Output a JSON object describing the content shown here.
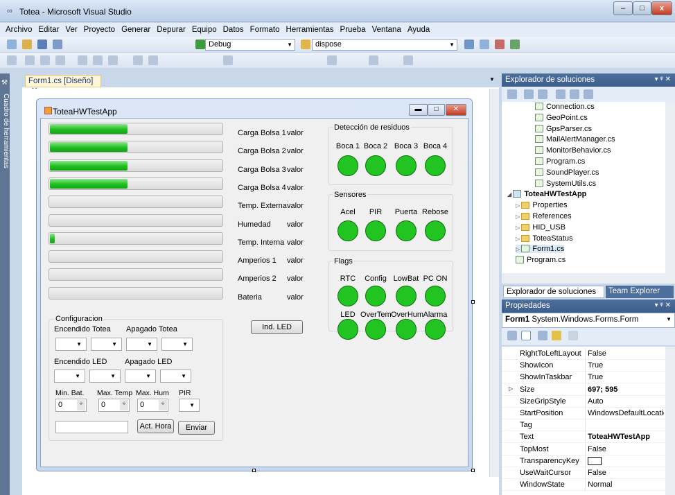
{
  "window": {
    "title": "Totea - Microsoft Visual Studio"
  },
  "menu": [
    "Archivo",
    "Editar",
    "Ver",
    "Proyecto",
    "Generar",
    "Depurar",
    "Equipo",
    "Datos",
    "Formato",
    "Herramientas",
    "Prueba",
    "Ventana",
    "Ayuda"
  ],
  "toolbar": {
    "config": "Debug",
    "platform": "dispose"
  },
  "left_rail": "Cuadro de herramientas",
  "document_tab": "Form1.cs [Diseño]",
  "form": {
    "title": "ToteaHWTestApp",
    "bars": [
      {
        "label": "Carga Bolsa 1",
        "value_label": "valor",
        "fill": 0.45
      },
      {
        "label": "Carga Bolsa 2",
        "value_label": "valor",
        "fill": 0.45
      },
      {
        "label": "Carga Bolsa 3",
        "value_label": "valor",
        "fill": 0.45
      },
      {
        "label": "Carga Bolsa 4",
        "value_label": "valor",
        "fill": 0.45
      },
      {
        "label": "Temp. Externa",
        "value_label": "valor",
        "fill": 0
      },
      {
        "label": "Humedad",
        "value_label": "valor",
        "fill": 0
      },
      {
        "label": "Temp. Interna",
        "value_label": "valor",
        "fill": 0.03
      },
      {
        "label": "Amperios 1",
        "value_label": "valor",
        "fill": 0
      },
      {
        "label": "Amperios 2",
        "value_label": "valor",
        "fill": 0
      },
      {
        "label": "Bateria",
        "value_label": "valor",
        "fill": 0
      }
    ],
    "ind_led_button": "Ind. LED",
    "groups": {
      "residuos": {
        "title": "Detección de residuos",
        "items": [
          "Boca 1",
          "Boca 2",
          "Boca 3",
          "Boca 4"
        ]
      },
      "sensores": {
        "title": "Sensores",
        "items": [
          "Acel",
          "PIR",
          "Puerta",
          "Rebose"
        ]
      },
      "flags": {
        "title": "Flags",
        "row1": [
          "RTC",
          "Config",
          "LowBat",
          "PC ON"
        ],
        "row2": [
          "LED",
          "OverTem",
          "OverHum",
          "Alarma"
        ]
      }
    },
    "config": {
      "title": "Configuracion",
      "encendido_totea": "Encendido Totea",
      "apagado_totea": "Apagado Totea",
      "encendido_led": "Encendido LED",
      "apagado_led": "Apagado LED",
      "min_bat": "Min. Bat.",
      "max_temp": "Max. Temp",
      "max_hum": "Max. Hum",
      "pir": "PIR",
      "min_bat_value": "0",
      "max_temp_value": "0",
      "max_hum_value": "0",
      "act_hora": "Act. Hora",
      "enviar": "Enviar"
    }
  },
  "solution_explorer": {
    "title": "Explorador de soluciones",
    "items": [
      {
        "label": "Connection.cs",
        "indent": 3,
        "type": "cs"
      },
      {
        "label": "GeoPoint.cs",
        "indent": 3,
        "type": "cs"
      },
      {
        "label": "GpsParser.cs",
        "indent": 3,
        "type": "cs"
      },
      {
        "label": "MailAlertManager.cs",
        "indent": 3,
        "type": "cs"
      },
      {
        "label": "MonitorBehavior.cs",
        "indent": 3,
        "type": "cs"
      },
      {
        "label": "Program.cs",
        "indent": 3,
        "type": "cs"
      },
      {
        "label": "SoundPlayer.cs",
        "indent": 3,
        "type": "cs"
      },
      {
        "label": "SystemUtils.cs",
        "indent": 3,
        "type": "cs"
      },
      {
        "label": "ToteaHWTestApp",
        "indent": 0,
        "type": "project",
        "bold": true,
        "expander": "◢"
      },
      {
        "label": "Properties",
        "indent": 1,
        "type": "folder",
        "expander": "▷"
      },
      {
        "label": "References",
        "indent": 1,
        "type": "folder",
        "expander": "▷"
      },
      {
        "label": "HID_USB",
        "indent": 1,
        "type": "folder",
        "expander": "▷"
      },
      {
        "label": "ToteaStatus",
        "indent": 1,
        "type": "folder",
        "expander": "▷"
      },
      {
        "label": "Form1.cs",
        "indent": 1,
        "type": "form",
        "expander": "▷"
      },
      {
        "label": "Program.cs",
        "indent": 1,
        "type": "cs"
      }
    ],
    "tab_active": "Explorador de soluciones",
    "tab_other": "Team Explorer"
  },
  "properties": {
    "title": "Propiedades",
    "object": "Form1",
    "object_type": "System.Windows.Forms.Form",
    "rows": [
      {
        "name": "RightToLeftLayout",
        "value": "False"
      },
      {
        "name": "ShowIcon",
        "value": "True"
      },
      {
        "name": "ShowInTaskbar",
        "value": "True"
      },
      {
        "name": "Size",
        "value": "697; 595",
        "bold": true,
        "expander": "▷"
      },
      {
        "name": "SizeGripStyle",
        "value": "Auto"
      },
      {
        "name": "StartPosition",
        "value": "WindowsDefaultLocation"
      },
      {
        "name": "Tag",
        "value": ""
      },
      {
        "name": "Text",
        "value": "ToteaHWTestApp",
        "bold": true
      },
      {
        "name": "TopMost",
        "value": "False"
      },
      {
        "name": "TransparencyKey",
        "value": "",
        "swatch": true
      },
      {
        "name": "UseWaitCursor",
        "value": "False"
      },
      {
        "name": "WindowState",
        "value": "Normal"
      }
    ]
  }
}
